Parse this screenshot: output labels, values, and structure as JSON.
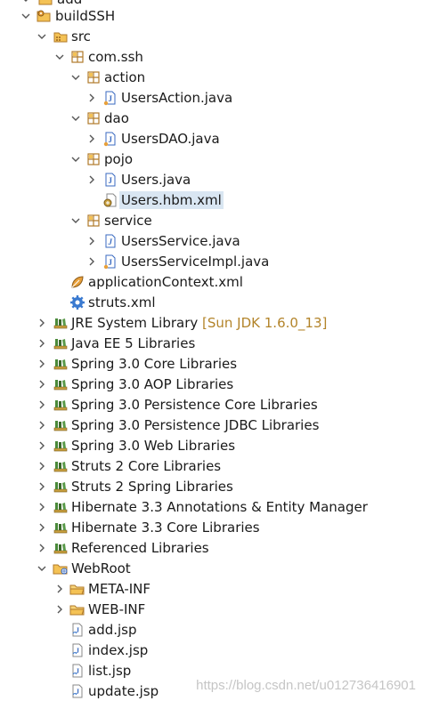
{
  "colors": {
    "selection_bg": "#d9e6f2",
    "decoration_text": "#b3842a",
    "chevron": "#555555",
    "package_brown": "#b07a2a",
    "folder_yellow": "#f4c255",
    "library_green": "#4a8a3a",
    "java_blue": "#3a6ac0"
  },
  "tree": {
    "top_partial_label": "add",
    "project": {
      "label": "buildSSH",
      "icon": "project-icon"
    },
    "src": {
      "label": "src",
      "icon": "source-folder-icon"
    },
    "com_ssh": {
      "label": "com.ssh",
      "icon": "package-icon"
    },
    "action": {
      "label": "action",
      "icon": "package-icon"
    },
    "users_action": {
      "label": "UsersAction.java",
      "icon": "java-class-icon"
    },
    "dao": {
      "label": "dao",
      "icon": "package-icon"
    },
    "users_dao": {
      "label": "UsersDAO.java",
      "icon": "java-class-icon"
    },
    "pojo": {
      "label": "pojo",
      "icon": "package-icon"
    },
    "users_java": {
      "label": "Users.java",
      "icon": "java-file-icon"
    },
    "users_hbm": {
      "label": "Users.hbm.xml",
      "icon": "hibernate-mapping-icon"
    },
    "service": {
      "label": "service",
      "icon": "package-icon"
    },
    "users_service": {
      "label": "UsersService.java",
      "icon": "java-interface-icon"
    },
    "users_service_impl": {
      "label": "UsersServiceImpl.java",
      "icon": "java-class-icon"
    },
    "app_context": {
      "label": "applicationContext.xml",
      "icon": "spring-leaf-icon"
    },
    "struts_xml": {
      "label": "struts.xml",
      "icon": "gear-icon"
    },
    "jre": {
      "label": "JRE System Library",
      "decoration": "[Sun JDK 1.6.0_13]",
      "icon": "library-icon"
    },
    "lib_javaee": {
      "label": "Java EE 5 Libraries",
      "icon": "library-icon"
    },
    "lib_spring_core": {
      "label": "Spring 3.0 Core Libraries",
      "icon": "library-icon"
    },
    "lib_spring_aop": {
      "label": "Spring 3.0 AOP Libraries",
      "icon": "library-icon"
    },
    "lib_spring_persist_core": {
      "label": "Spring 3.0 Persistence Core Libraries",
      "icon": "library-icon"
    },
    "lib_spring_persist_jdbc": {
      "label": "Spring 3.0 Persistence JDBC Libraries",
      "icon": "library-icon"
    },
    "lib_spring_web": {
      "label": "Spring 3.0 Web Libraries",
      "icon": "library-icon"
    },
    "lib_struts_core": {
      "label": "Struts 2 Core Libraries",
      "icon": "library-icon"
    },
    "lib_struts_spring": {
      "label": "Struts 2 Spring Libraries",
      "icon": "library-icon"
    },
    "lib_hib_annotations": {
      "label": "Hibernate 3.3 Annotations & Entity Manager",
      "icon": "library-icon"
    },
    "lib_hib_core": {
      "label": "Hibernate 3.3 Core Libraries",
      "icon": "library-icon"
    },
    "lib_referenced": {
      "label": "Referenced Libraries",
      "icon": "library-icon"
    },
    "webroot": {
      "label": "WebRoot",
      "icon": "web-folder-icon"
    },
    "meta_inf": {
      "label": "META-INF",
      "icon": "folder-icon"
    },
    "web_inf": {
      "label": "WEB-INF",
      "icon": "folder-icon"
    },
    "add_jsp": {
      "label": "add.jsp",
      "icon": "jsp-file-icon"
    },
    "index_jsp": {
      "label": "index.jsp",
      "icon": "jsp-file-icon"
    },
    "list_jsp": {
      "label": "list.jsp",
      "icon": "jsp-file-icon"
    },
    "update_jsp": {
      "label": "update.jsp",
      "icon": "jsp-file-icon"
    }
  },
  "watermark": "https://blog.csdn.net/u012736416901"
}
